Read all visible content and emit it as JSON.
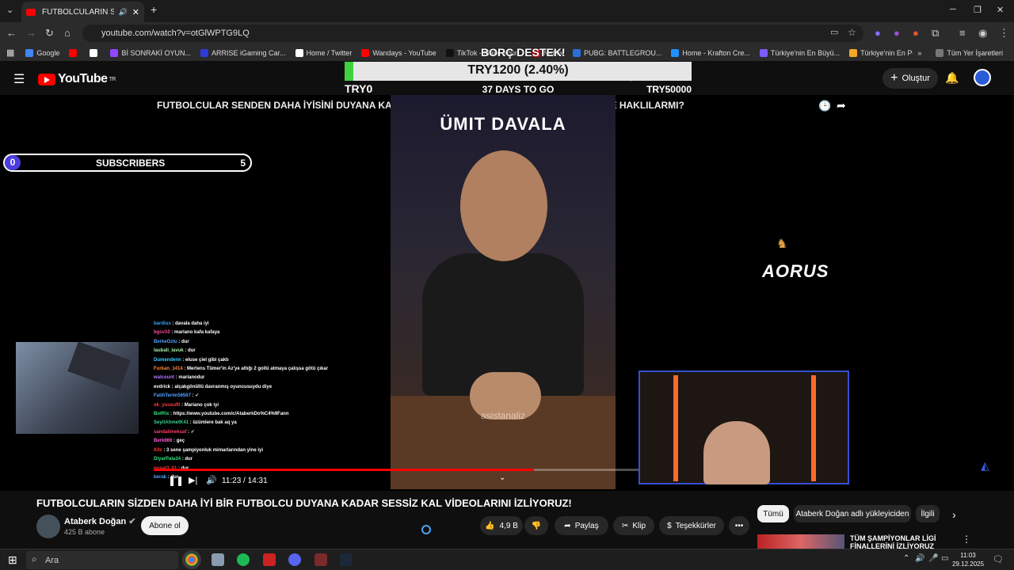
{
  "browser": {
    "tab_title": "FUTBOLCULARIN SİZDEN D",
    "url": "youtube.com/watch?v=otGlWPTG9LQ",
    "bookmarks": [
      {
        "label": "Google",
        "color": "#4285f4"
      },
      {
        "label": "",
        "color": "#ff0000"
      },
      {
        "label": "",
        "color": "#ffffff"
      },
      {
        "label": "Bİ SONRAKİ OYUN...",
        "color": "#9146ff"
      },
      {
        "label": "ARRISE iGaming Car...",
        "color": "#2f3ad8"
      },
      {
        "label": "Home / Twitter",
        "color": "#ffffff"
      },
      {
        "label": "Wandays - YouTube",
        "color": "#ff0000"
      },
      {
        "label": "TikTok - Make Your...",
        "color": "#111111"
      },
      {
        "label": "Netflix",
        "color": "#e50914"
      },
      {
        "label": "PUBG: BATTLEGROU...",
        "color": "#2a6fd6"
      },
      {
        "label": "Home - Krafton Cre...",
        "color": "#1e90ff"
      },
      {
        "label": "Türkiye'nin En Büyü...",
        "color": "#7a5cff"
      },
      {
        "label": "Türkiye'nin En Popül...",
        "color": "#f5a623"
      }
    ],
    "all_bookmarks_label": "Tüm Yer İşaretleri"
  },
  "youtube": {
    "logo": "YouTube",
    "logo_region": "TR",
    "create_label": "Oluştur"
  },
  "video": {
    "overlay_title": "FUTBOLCULAR SENDEN DAHA İYİSİNİ DUYANA KADAR SESSİZ KAL VİDEOLARI DERLEME!! | SİZCE HAKLILARMI?",
    "inner_name": "ÜMIT DAVALA",
    "watermark": "asistanaliz",
    "goal": {
      "label": "BORÇ DESTEK!",
      "value": "TRY1200 (2.40%)",
      "fraction": 0.024,
      "low": "TRY0",
      "high": "TRY50000",
      "days": "37 DAYS TO GO"
    },
    "subs_widget": {
      "left": "0",
      "middle": "SUBSCRIBERS",
      "right": "5"
    },
    "brand": "AORUS",
    "time": "11:23 / 14:31",
    "progress": 0.784,
    "chat": [
      {
        "user": "bardius",
        "color": "#30a3ff",
        "msg": "davala daha iyi"
      },
      {
        "user": "bgcv10",
        "color": "#ff4fa0",
        "msg": "mariano kafa kafaya"
      },
      {
        "user": "BerkeOzlu",
        "color": "#4fa3ff",
        "msg": "dur"
      },
      {
        "user": "laubali_lavuk",
        "color": "#a6f0a6",
        "msg": "dur"
      },
      {
        "user": "Dumendenn",
        "color": "#3ecfff",
        "msg": "eluse çiel gibi çaktı"
      },
      {
        "user": "Furkan_1414",
        "color": "#ff8a3d",
        "msg": "Mertens Tümer'in Az'ye attığı 2 gollü atmaya çalışsa götü çıkar"
      },
      {
        "user": "walcount",
        "color": "#b07aff",
        "msg": "marianodur"
      },
      {
        "user": "evdrick",
        "color": "#ffffff",
        "msg": "alçakgönüllü davranmış oyuncusuydu diye"
      },
      {
        "user": "FatihTerim56567",
        "color": "#4fa3ff",
        "msg": "✓"
      },
      {
        "user": "ok_yuusuf0",
        "color": "#ff3b3b",
        "msg": "Mariano çok iyi"
      },
      {
        "user": "BotRix",
        "color": "#38e07a",
        "msg": "https://www.youtube.com/c/AtaberkDo%C4%9Fann"
      },
      {
        "user": "SeyitAhmetK41",
        "color": "#3ecf8e",
        "msg": "üzümlere bak aq ya"
      },
      {
        "user": "sandalimeksaf",
        "color": "#ff3b6b",
        "msg": "✓"
      },
      {
        "user": "Berk666",
        "color": "#ff5ad0",
        "msg": "geç"
      },
      {
        "user": "K0z",
        "color": "#ff3b3b",
        "msg": "3 sene şampiyonluk mimarlarından yine iyi"
      },
      {
        "user": "DiyarPala34",
        "color": "#38e07a",
        "msg": "dur"
      },
      {
        "user": "pusat3_01",
        "color": "#ff3b3b",
        "msg": "dur"
      },
      {
        "user": "berak",
        "color": "#4fa3ff",
        "msg": "dur"
      }
    ]
  },
  "below": {
    "title": "FUTBOLCULARIN SİZDEN DAHA İYİ BİR FUTBOLCU DUYANA KADAR SESSİZ KAL VİDEOLARINI İZLİYORUZ!",
    "channel": "Ataberk Doğan",
    "subscribers": "425 B abone",
    "subscribe_label": "Abone ol",
    "likes": "4,9 B",
    "share": "Paylaş",
    "clip": "Klip",
    "thanks": "Teşekkürler",
    "chips": [
      "Tümü",
      "Ataberk Doğan adlı yükleyiciden",
      "İlgili"
    ],
    "next_title": "TÜM ŞAMPİYONLAR LİGİ FİNALLERİNİ İZLİYORUZ"
  },
  "taskbar": {
    "search_placeholder": "Ara",
    "time": "11:03",
    "date": "29.12.2025"
  }
}
